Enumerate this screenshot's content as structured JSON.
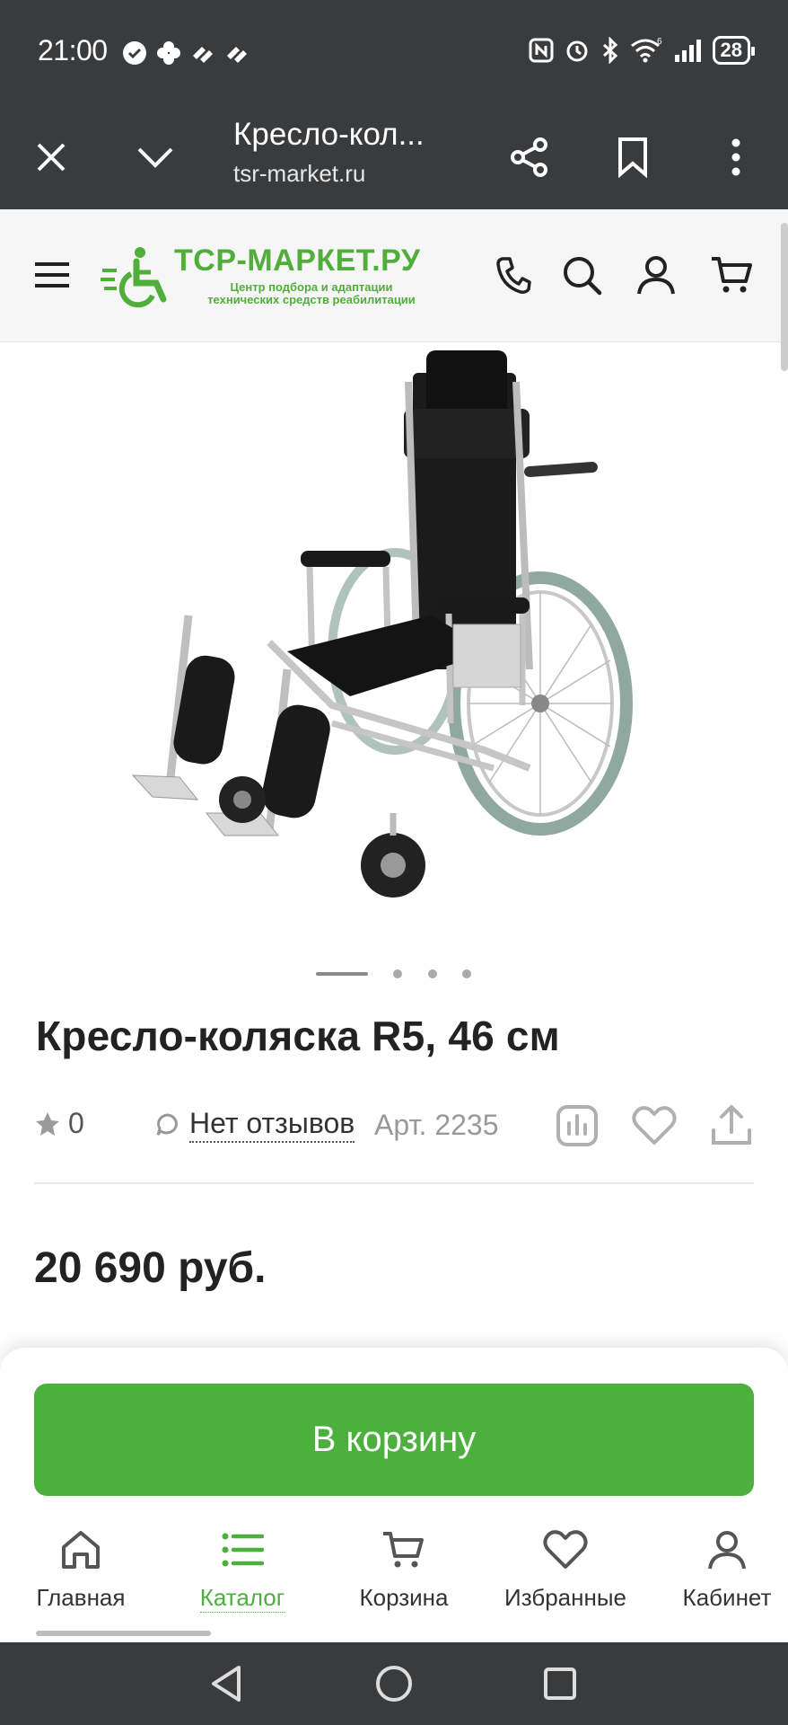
{
  "status_bar": {
    "time": "21:00",
    "battery": "28",
    "icons": [
      "check-circle-icon",
      "clover-icon",
      "signal-check-icon",
      "signal-check-icon",
      "nfc-icon",
      "alarm-icon",
      "bluetooth-icon",
      "wifi-6-icon",
      "cell-signal-icon",
      "battery-icon"
    ]
  },
  "browser": {
    "page_title": "Кресло-кол...",
    "url": "tsr-market.ru",
    "icons": [
      "close-icon",
      "chevron-down-icon",
      "share-icon",
      "bookmark-icon",
      "more-vert-icon"
    ]
  },
  "site_header": {
    "logo_main": "ТСР-МАРКЕТ.РУ",
    "logo_sub_line1": "Центр подбора и адаптации",
    "logo_sub_line2": "технических средств реабилитации",
    "brand_color": "#52ae3b",
    "icons": [
      "menu-icon",
      "phone-icon",
      "search-icon",
      "user-icon",
      "cart-icon"
    ]
  },
  "gallery": {
    "slides": 4,
    "active_index": 0
  },
  "product": {
    "title": "Кресло-коляска R5, 46 см",
    "rating_value": "0",
    "reviews_label": "Нет отзывов",
    "article": "Арт. 2235",
    "price": "20 690 руб.",
    "action_icons": [
      "compare-icon",
      "heart-icon",
      "upload-share-icon"
    ]
  },
  "bottom_sheet": {
    "add_to_cart_label": "В корзину",
    "accent_color": "#4caf3e"
  },
  "tabbar": {
    "items": [
      {
        "label": "Главная",
        "icon": "home-icon",
        "active": false
      },
      {
        "label": "Каталог",
        "icon": "list-icon",
        "active": true
      },
      {
        "label": "Корзина",
        "icon": "cart-icon",
        "active": false
      },
      {
        "label": "Избранные",
        "icon": "heart-icon",
        "active": false
      },
      {
        "label": "Кабинет",
        "icon": "user-icon",
        "active": false
      }
    ]
  },
  "navbar": {
    "icons": [
      "back-triangle-icon",
      "home-circle-icon",
      "recents-square-icon"
    ]
  }
}
